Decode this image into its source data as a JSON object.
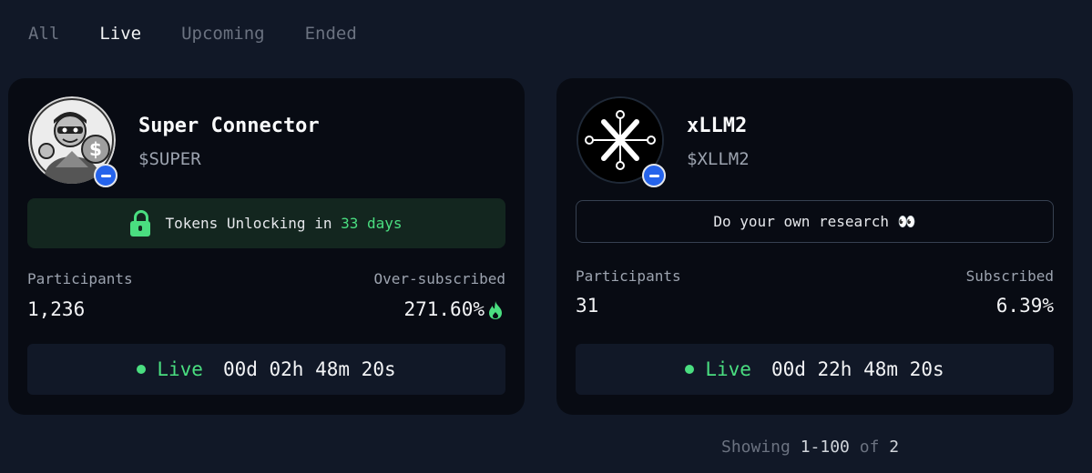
{
  "tabs": [
    "All",
    "Live",
    "Upcoming",
    "Ended"
  ],
  "active_tab": "Live",
  "cards": [
    {
      "name": "Super Connector",
      "ticker": "$SUPER",
      "banner_prefix": "Tokens Unlocking in",
      "banner_highlight": "33 days",
      "participants_label": "Participants",
      "participants": "1,236",
      "sub_label": "Over-subscribed",
      "sub_value": "271.60%",
      "status": "Live",
      "countdown": "00d 02h 48m 20s"
    },
    {
      "name": "xLLM2",
      "ticker": "$XLLM2",
      "banner_text": "Do your own research 👀",
      "participants_label": "Participants",
      "participants": "31",
      "sub_label": "Subscribed",
      "sub_value": "6.39%",
      "status": "Live",
      "countdown": "00d 22h 48m 20s"
    }
  ],
  "pagination": {
    "prefix": "Showing",
    "range": "1-100",
    "of": "of",
    "total": "2"
  },
  "colors": {
    "accent_green": "#4ade80",
    "badge_blue": "#2563eb"
  }
}
